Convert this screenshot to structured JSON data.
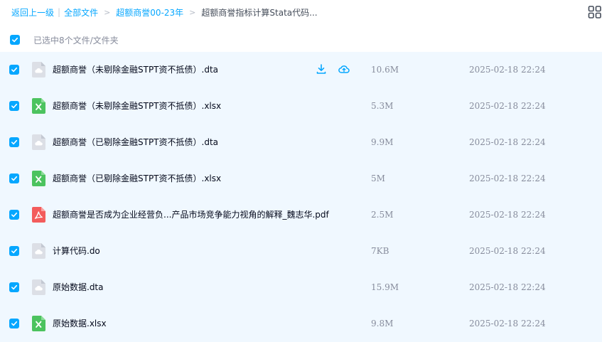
{
  "breadcrumb": {
    "back": "返回上一级",
    "pipe": "|",
    "all_files": "全部文件",
    "sep1": ">",
    "folder": "超额商誉00-23年",
    "sep2": ">",
    "current": "超额商誉指标计算Stata代码..."
  },
  "selection": {
    "label": "已选中8个文件/文件夹"
  },
  "colors": {
    "accent": "#06a7ff",
    "row_bg": "#f0f8ff",
    "excel": "#4cc35f",
    "pdf": "#f35c5c",
    "generic": "#d9dde5"
  },
  "files": [
    {
      "name": "超额商誉（未剔除金融STPT资不抵债）.dta",
      "size": "10.6M",
      "time": "2025-02-18 22:24",
      "icon": "generic-file-icon"
    },
    {
      "name": "超额商誉（未剔除金融STPT资不抵债）.xlsx",
      "size": "5.3M",
      "time": "2025-02-18 22:24",
      "icon": "excel-file-icon"
    },
    {
      "name": "超额商誉（已剔除金融STPT资不抵债）.dta",
      "size": "9.9M",
      "time": "2025-02-18 22:24",
      "icon": "generic-file-icon"
    },
    {
      "name": "超额商誉（已剔除金融STPT资不抵债）.xlsx",
      "size": "5M",
      "time": "2025-02-18 22:24",
      "icon": "excel-file-icon"
    },
    {
      "name": "超额商誉是否成为企业经营负...产品市场竞争能力视角的解释_魏志华.pdf",
      "size": "2.5M",
      "time": "2025-02-18 22:24",
      "icon": "pdf-file-icon"
    },
    {
      "name": "计算代码.do",
      "size": "7KB",
      "time": "2025-02-18 22:24",
      "icon": "generic-file-icon"
    },
    {
      "name": "原始数据.dta",
      "size": "15.9M",
      "time": "2025-02-18 22:24",
      "icon": "generic-file-icon"
    },
    {
      "name": "原始数据.xlsx",
      "size": "9.8M",
      "time": "2025-02-18 22:24",
      "icon": "excel-file-icon"
    }
  ]
}
